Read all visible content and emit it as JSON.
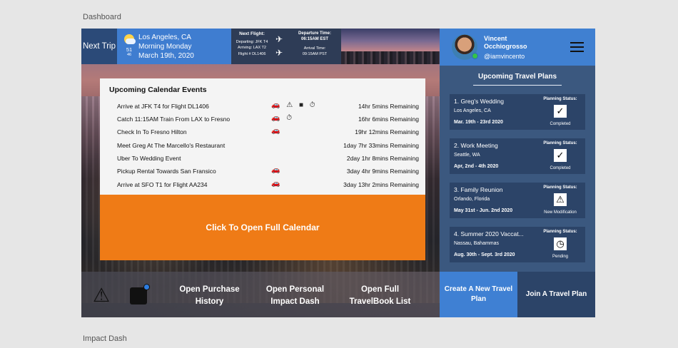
{
  "artboards": {
    "top_label": "Dashboard",
    "bottom_label": "Impact Dash"
  },
  "header": {
    "next_trip_label": "Next Trip",
    "weather": {
      "icon": "partly-cloudy-icon",
      "temp": "51",
      "low": "46"
    },
    "trip": {
      "city": "Los Angeles, CA",
      "day": "Morning Monday",
      "date": "March 19th, 2020"
    },
    "flight": {
      "next_flight_label": "Next Flight:",
      "departing": "Departing: JFK T4",
      "arriving": "Arriving: LAX T2",
      "flight_no": "Flight # DL1406",
      "departure_label": "Departure Time:",
      "departure_time": "06:15AM EST",
      "arrival_label": "Arrival Time:",
      "arrival_time": "09:15AM PST"
    }
  },
  "profile": {
    "first_name": "Vincent",
    "last_name": "Occhiogrosso",
    "handle": "@iamvincento"
  },
  "calendar": {
    "title": "Upcoming Calendar Events",
    "events": [
      {
        "name": "Arrive at JFK T4 for Flight DL1406",
        "icons": "🚗 ⚠ ■ ⏱",
        "remaining": "14hr 5mins Remaining"
      },
      {
        "name": "Catch 11:15AM Train From LAX to Fresno",
        "icons": "🚗 ⏱",
        "remaining": "16hr 6mins Remaining"
      },
      {
        "name": "Check In To Fresno Hilton",
        "icons": "🚗",
        "remaining": "19hr 12mins Remaining"
      },
      {
        "name": "Meet Greg At The Marcello's Restaurant",
        "icons": "",
        "remaining": "1day 7hr 33mins Remaining"
      },
      {
        "name": "Uber To Wedding Event",
        "icons": "",
        "remaining": "2day 1hr 8mins Remaining"
      },
      {
        "name": "Pickup Rental Towards San Fransico",
        "icons": "🚗",
        "remaining": "3day 4hr 9mins Remaining"
      },
      {
        "name": "Arrive at SFO T1 for Flight AA234",
        "icons": "🚗",
        "remaining": "3day 13hr 2mins Remaining"
      }
    ],
    "open_full_label": "Click To Open Full Calendar"
  },
  "bottom_bar": {
    "purchase_history": "Open Purchase History",
    "impact_dash": "Open Personal Impact Dash",
    "travelbook": "Open Full TravelBook List"
  },
  "travel_plans": {
    "title": "Upcoming Travel Plans",
    "status_label": "Planning Status:",
    "plans": [
      {
        "name": "1. Greg's Wedding",
        "location": "Los Angeles, CA",
        "dates": "Mar. 19th - 23rd 2020",
        "status_icon": "✓",
        "status": "Completed"
      },
      {
        "name": "2. Work Meeting",
        "location": "Seattle, WA",
        "dates": "Apr, 2nd - 4th 2020",
        "status_icon": "✓",
        "status": "Completed"
      },
      {
        "name": "3. Family Reunion",
        "location": "Orlando, Florida",
        "dates": "May 31st - Jun. 2nd 2020",
        "status_icon": "⚠",
        "status": "New Modification"
      },
      {
        "name": "4. Summer 2020 Vaccat...",
        "location": "Nassau, Bahammas",
        "dates": "Aug. 30th - Sept. 3rd 2020",
        "status_icon": "◷",
        "status": "Pending"
      }
    ],
    "create_label": "Create A New Travel Plan",
    "join_label": "Join A Travel Plan"
  }
}
